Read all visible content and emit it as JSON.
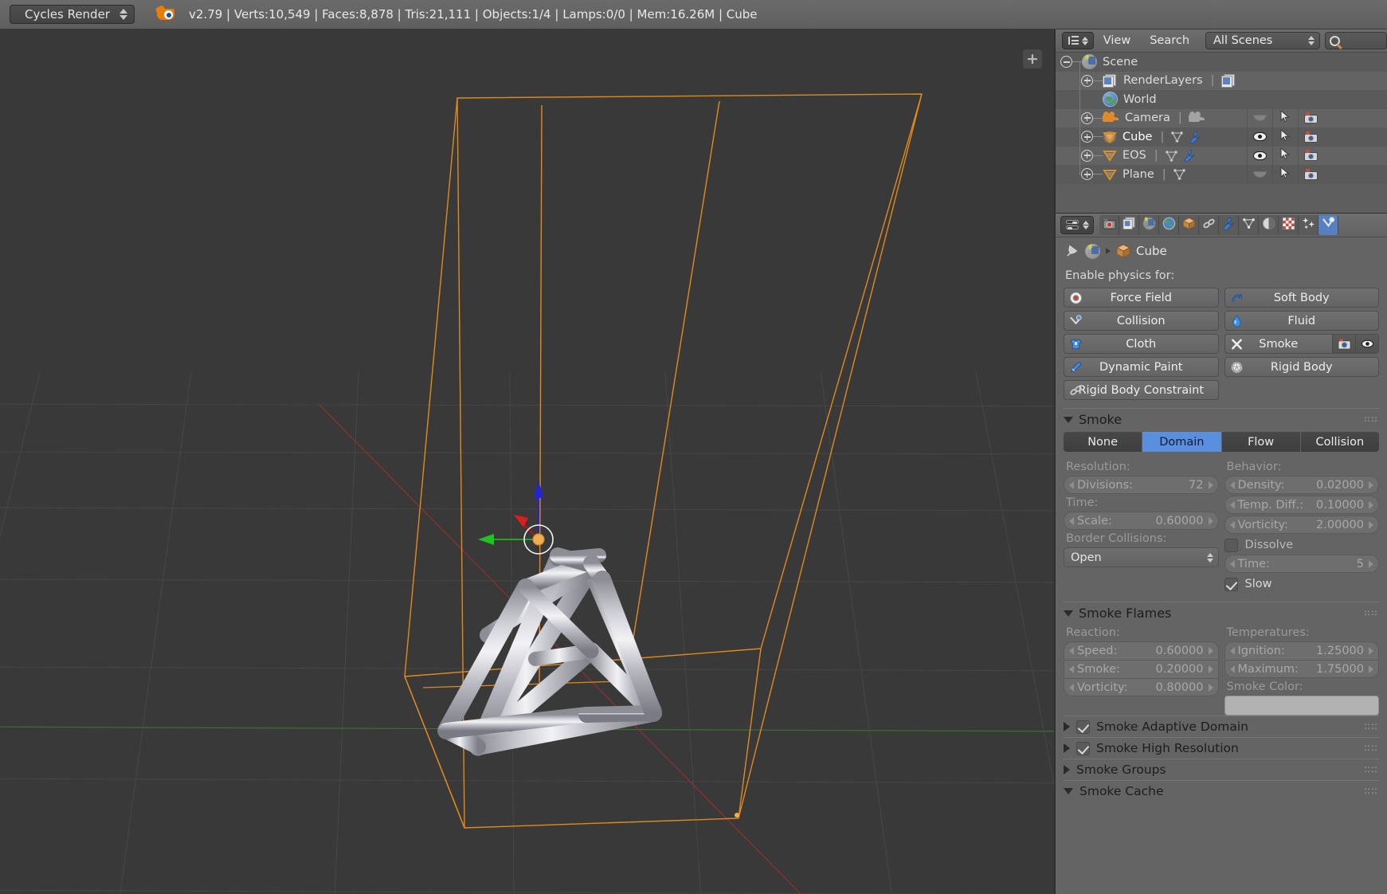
{
  "topbar": {
    "engine": "Cycles Render",
    "logo_icon": "blender-logo-icon",
    "status": "v2.79 | Verts:10,549 | Faces:8,878 | Tris:21,111 | Objects:1/4 | Lamps:0/0 | Mem:16.26M | Cube"
  },
  "viewport": {
    "add_button": "+",
    "background_color": "#393939",
    "wire_color": "#e08a1e",
    "x_axis_color": "#9b3b3b",
    "y_axis_color": "#3d7a34",
    "manipulator": {
      "x_color": "#d81f1f",
      "y_color": "#1fc41f",
      "z_color": "#2222dd",
      "origin_color": "#f0b050"
    }
  },
  "outliner": {
    "mode_icon": "outliner-mode-icon",
    "menus": [
      "View",
      "Search"
    ],
    "scene_filter": "All Scenes",
    "search_placeholder": "",
    "search_icon": "search-icon",
    "rows": [
      {
        "label": "Scene",
        "indent": 0,
        "expander": "minus",
        "icon": "scene-icon",
        "selected": false,
        "extra": [],
        "cols": []
      },
      {
        "label": "RenderLayers",
        "indent": 1,
        "expander": "plus",
        "icon": "renderlayer-icon",
        "selected": false,
        "extra": [
          "renderlayer-icon"
        ],
        "cols": []
      },
      {
        "label": "World",
        "indent": 1,
        "expander": "none",
        "icon": "world-icon",
        "selected": false,
        "extra": [],
        "cols": []
      },
      {
        "label": "Camera",
        "indent": 1,
        "expander": "plus",
        "icon": "camera-icon",
        "selected": false,
        "extra": [
          "camera-data-icon"
        ],
        "cols": [
          "eye-off",
          "cursor-arrow",
          "camera-render"
        ]
      },
      {
        "label": "Cube",
        "indent": 1,
        "expander": "plus",
        "icon": "mesh-icon",
        "selected": true,
        "extra": [
          "mesh-data-icon",
          "modifier-wrench-icon"
        ],
        "cols": [
          "eye-on",
          "cursor-arrow",
          "camera-render"
        ]
      },
      {
        "label": "EOS",
        "indent": 1,
        "expander": "plus",
        "icon": "mesh-icon",
        "selected": false,
        "extra": [
          "mesh-data-icon",
          "modifier-wrench-icon"
        ],
        "cols": [
          "eye-on",
          "cursor-arrow",
          "camera-render"
        ]
      },
      {
        "label": "Plane",
        "indent": 1,
        "expander": "plus",
        "icon": "mesh-icon",
        "selected": false,
        "extra": [
          "mesh-data-icon"
        ],
        "cols": [
          "eye-off",
          "cursor-arrow",
          "camera-render"
        ]
      }
    ]
  },
  "properties": {
    "mode_icon": "editor-type-icon",
    "tabs": [
      {
        "name": "render",
        "icon": "camera-back-icon",
        "active": false
      },
      {
        "name": "render-layers",
        "icon": "render-layers-icon",
        "active": false
      },
      {
        "name": "scene",
        "icon": "scene-icon",
        "active": false
      },
      {
        "name": "world",
        "icon": "world-icon",
        "active": false
      },
      {
        "name": "object",
        "icon": "cube-icon",
        "active": false
      },
      {
        "name": "constraints",
        "icon": "chain-icon",
        "active": false
      },
      {
        "name": "modifiers",
        "icon": "wrench-icon",
        "active": false
      },
      {
        "name": "data",
        "icon": "mesh-data-icon",
        "active": false
      },
      {
        "name": "material",
        "icon": "material-ball-icon",
        "active": false
      },
      {
        "name": "texture",
        "icon": "checker-icon",
        "active": false
      },
      {
        "name": "particles",
        "icon": "particles-icon",
        "active": false
      },
      {
        "name": "physics",
        "icon": "physics-icon",
        "active": true
      }
    ],
    "breadcrumb": {
      "pin_icon": "pin-icon",
      "scene_icon": "scene-icon",
      "arrow_icon": "chevron-right-icon",
      "object_icon": "cube-icon",
      "object": "Cube"
    },
    "enable_physics_label": "Enable physics for:",
    "physics_buttons": [
      {
        "label": "Force Field",
        "icon": "force-field-icon",
        "wide": false,
        "extras": []
      },
      {
        "label": "Soft Body",
        "icon": "soft-body-icon",
        "wide": false,
        "extras": []
      },
      {
        "label": "Collision",
        "icon": "collision-icon",
        "wide": false,
        "extras": []
      },
      {
        "label": "Fluid",
        "icon": "fluid-drop-icon",
        "wide": false,
        "extras": []
      },
      {
        "label": "Cloth",
        "icon": "cloth-icon",
        "wide": false,
        "extras": []
      },
      {
        "label": "Smoke",
        "icon": "x-close-icon",
        "wide": false,
        "extras": [
          "camera-render-icon",
          "eye-icon"
        ]
      },
      {
        "label": "Dynamic Paint",
        "icon": "dynamic-paint-icon",
        "wide": false,
        "extras": []
      },
      {
        "label": "Rigid Body",
        "icon": "rigid-body-icon",
        "wide": false,
        "extras": []
      },
      {
        "label": "Rigid Body Constraint",
        "icon": "chain-icon",
        "wide": false,
        "extras": []
      }
    ],
    "smoke_panel": {
      "title": "Smoke",
      "types": [
        "None",
        "Domain",
        "Flow",
        "Collision"
      ],
      "active_type": "Domain",
      "left_labels": {
        "resolution": "Resolution:",
        "time": "Time:",
        "border": "Border Collisions:"
      },
      "right_labels": {
        "behavior": "Behavior:"
      },
      "divisions": {
        "name": "Divisions:",
        "value": "72"
      },
      "scale": {
        "name": "Scale:",
        "value": "0.60000"
      },
      "border_collisions": "Open",
      "density": {
        "name": "Density:",
        "value": "0.02000"
      },
      "temp_diff": {
        "name": "Temp. Diff.:",
        "value": "0.10000"
      },
      "vorticity": {
        "name": "Vorticity:",
        "value": "2.00000"
      },
      "dissolve": {
        "label": "Dissolve",
        "checked": false
      },
      "dissolve_time": {
        "name": "Time:",
        "value": "5"
      },
      "slow": {
        "label": "Slow",
        "checked": true
      }
    },
    "smoke_flames_panel": {
      "title": "Smoke Flames",
      "reaction_label": "Reaction:",
      "temperatures_label": "Temperatures:",
      "speed": {
        "name": "Speed:",
        "value": "0.60000"
      },
      "smoke": {
        "name": "Smoke:",
        "value": "0.20000"
      },
      "vorticity": {
        "name": "Vorticity:",
        "value": "0.80000"
      },
      "ignition": {
        "name": "Ignition:",
        "value": "1.25000"
      },
      "maximum": {
        "name": "Maximum:",
        "value": "1.75000"
      },
      "smoke_color_label": "Smoke Color:",
      "smoke_color": "#b2b2b2"
    },
    "collapsed_panels": [
      {
        "title": "Smoke Adaptive Domain",
        "checkbox": true,
        "checked": true
      },
      {
        "title": "Smoke High Resolution",
        "checkbox": true,
        "checked": true
      },
      {
        "title": "Smoke Groups",
        "checkbox": false,
        "checked": false
      }
    ],
    "cache_panel": {
      "title": "Smoke Cache"
    }
  }
}
